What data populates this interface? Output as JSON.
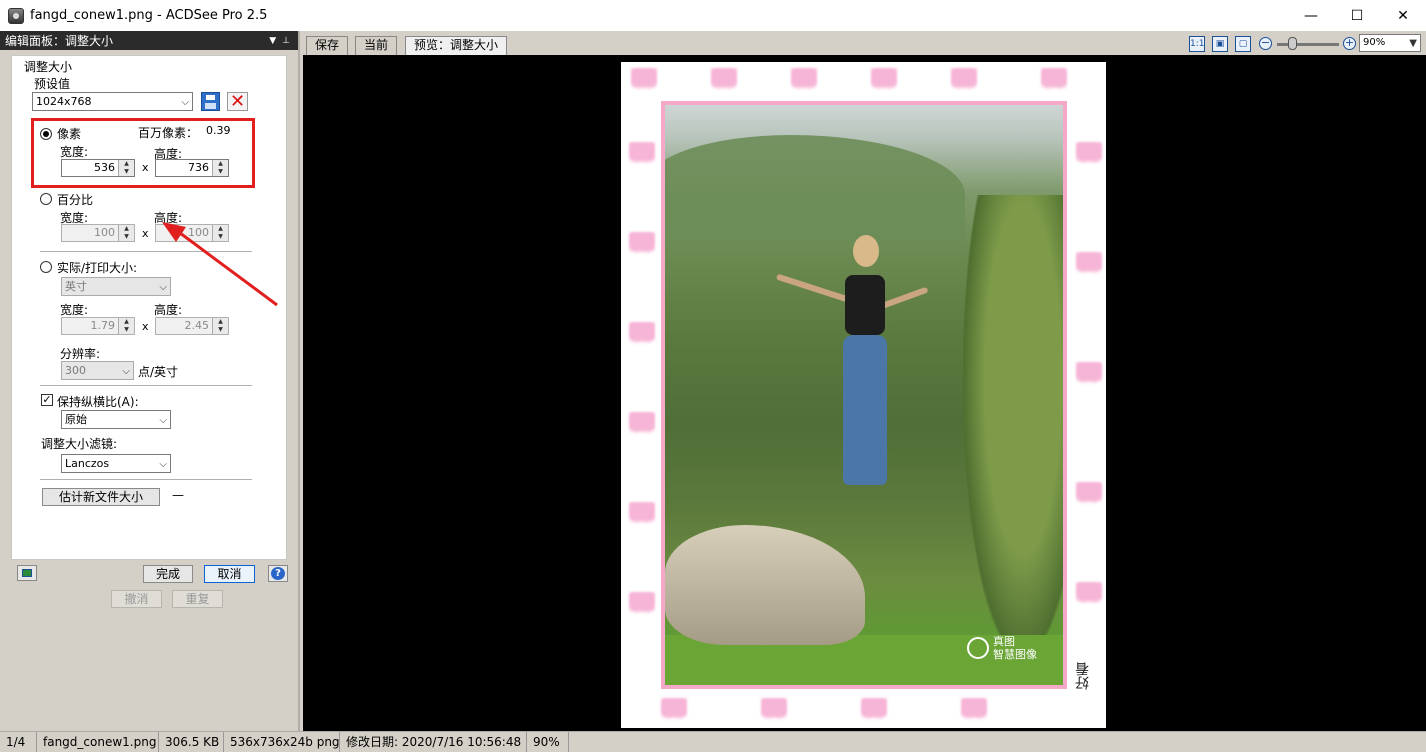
{
  "window": {
    "title": "fangd_conew1.png - ACDSee Pro 2.5",
    "min": "—",
    "max": "☐",
    "close": "✕"
  },
  "panel": {
    "header": "编辑面板：调整大小",
    "section_title": "调整大小",
    "preset_label": "预设值",
    "preset_value": "1024x768",
    "pixels": {
      "label": "像素",
      "megapixel_label": "百万像素：",
      "megapixel_value": "0.39",
      "width_label": "宽度:",
      "height_label": "高度:",
      "width": "536",
      "height": "736",
      "x": "x"
    },
    "percent": {
      "label": "百分比",
      "width_label": "宽度:",
      "height_label": "高度:",
      "width": "100",
      "height": "100",
      "x": "x"
    },
    "print": {
      "label": "实际/打印大小:",
      "unit": "英寸",
      "width_label": "宽度:",
      "height_label": "高度:",
      "width": "1.79",
      "height": "2.45",
      "x": "x",
      "res_label": "分辨率:",
      "res_value": "300",
      "res_unit": "点/英寸"
    },
    "aspect": {
      "label": "保持纵横比(A):",
      "checked": true,
      "value": "原始"
    },
    "filter": {
      "label": "调整大小滤镜:",
      "value": "Lanczos"
    },
    "estimate_button": "估计新文件大小",
    "estimate_value": "—",
    "done": "完成",
    "cancel": "取消",
    "undo": "撤消",
    "redo": "重复",
    "help": "?"
  },
  "tabs": [
    {
      "label": "保存"
    },
    {
      "label": "当前"
    },
    {
      "label": "预览：调整大小"
    }
  ],
  "toolbar": {
    "zoom": "90%",
    "icon1": "1:1"
  },
  "image": {
    "watermark_line1": "真图",
    "watermark_line2": "智慧图像",
    "signature": "好看"
  },
  "status": {
    "index": "1/4",
    "filename": "fangd_conew1.png",
    "size": "306.5 KB",
    "dims": "536x736x24b png",
    "modified": "修改日期: 2020/7/16 10:56:48",
    "zoom": "90%"
  },
  "colors": {
    "highlight_red": "#e21f1f",
    "frame_pink": "#f4a9c9",
    "panel_header": "#2b2b2b"
  }
}
